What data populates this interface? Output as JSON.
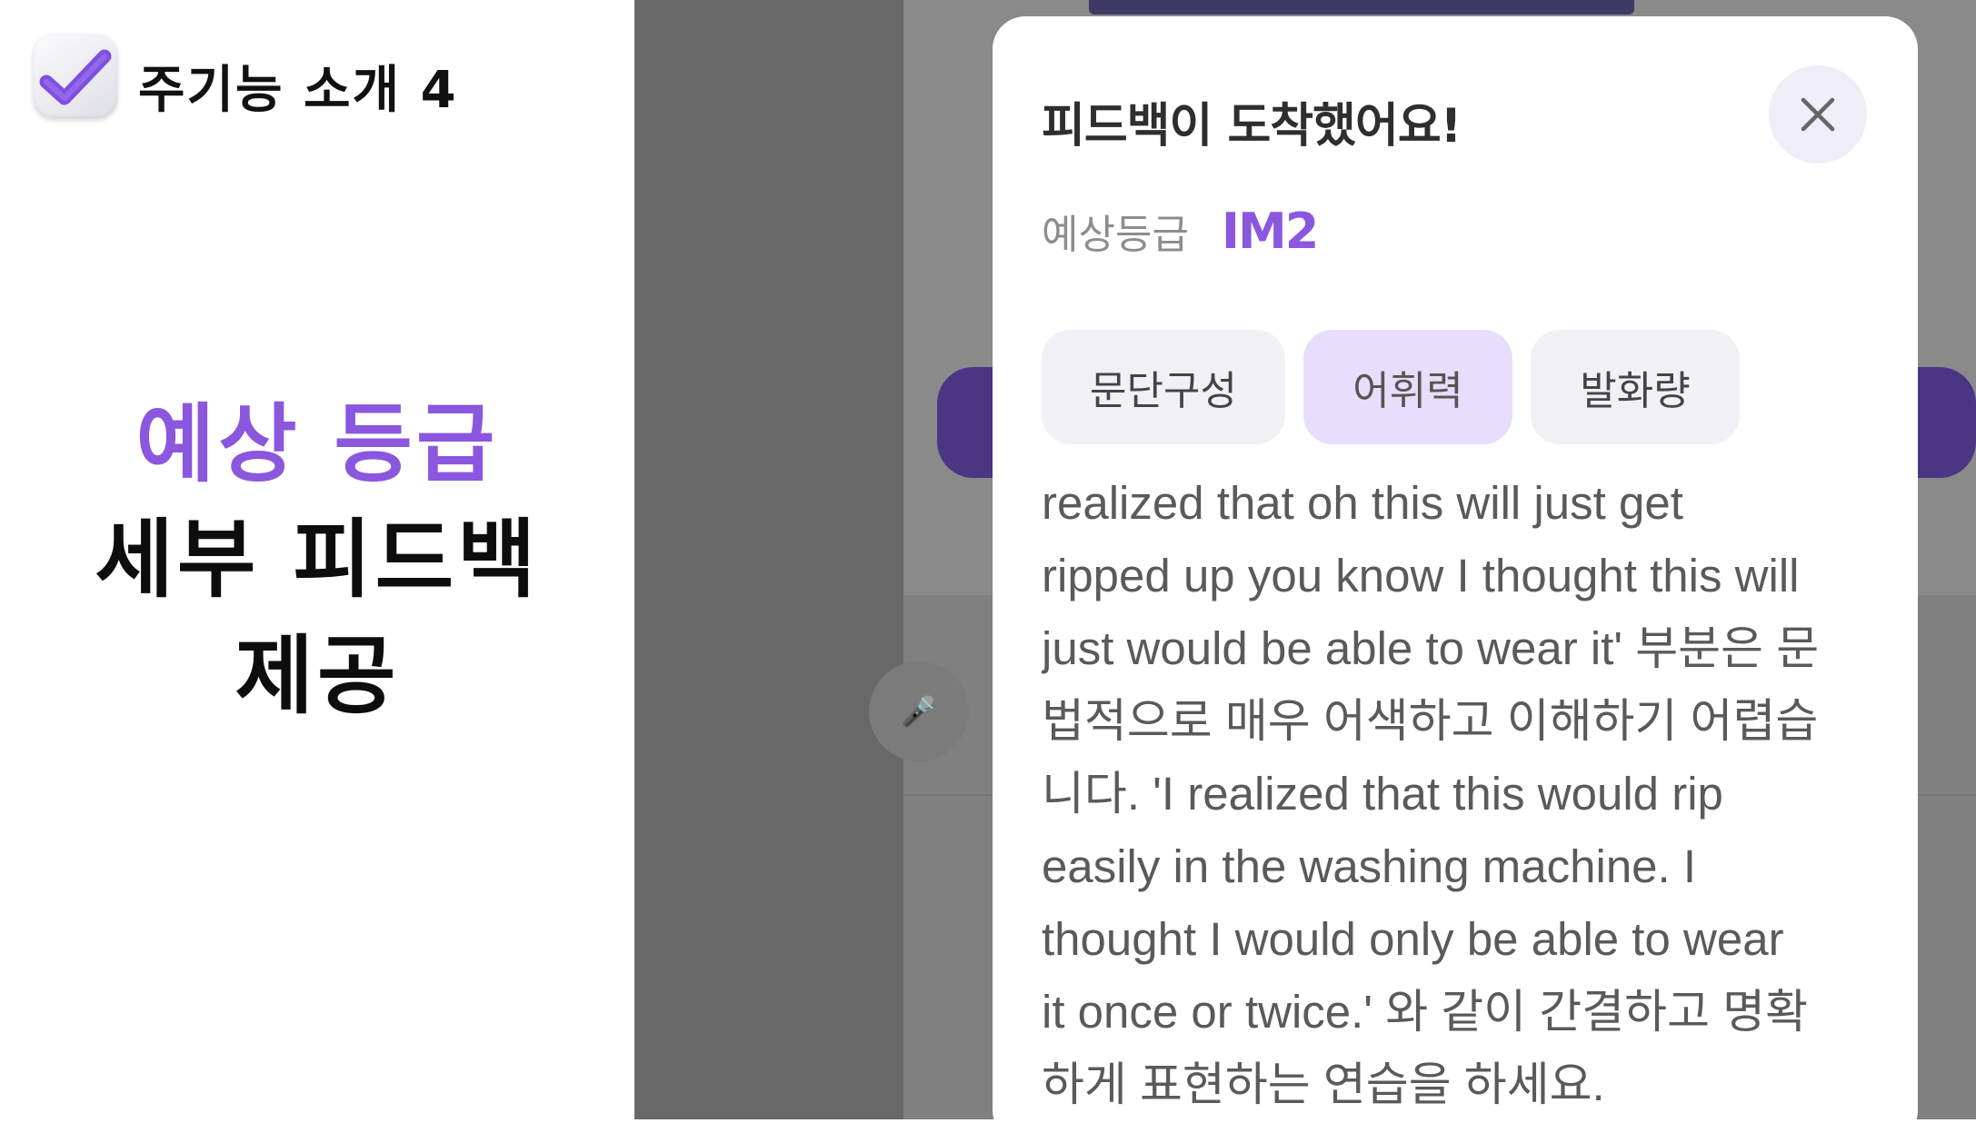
{
  "promo": {
    "feature_title": "주기능 소개 4",
    "headline_purple": "예상 등급",
    "headline_line2": "세부 피드백",
    "headline_line3": "제공"
  },
  "icons": {
    "app": "checkbox-check-icon",
    "close": "close-icon",
    "mic": "microphone-icon"
  },
  "colors": {
    "accent": "#8a57de",
    "active_tab_bg": "#e7defb",
    "tab_bg": "#f1f1f5",
    "backdrop": "#8a8a8a"
  },
  "modal": {
    "title": "피드백이 도착했어요!",
    "grade_label": "예상등급",
    "grade_value": "IM2",
    "tabs": [
      {
        "label": "문단구성",
        "active": false
      },
      {
        "label": "어휘력",
        "active": true
      },
      {
        "label": "발화량",
        "active": false
      }
    ],
    "feedback_text": "realized that oh this will just get\nripped up you know I thought this will\njust would be able to wear it' 부분은 문\n법적으로 매우 어색하고 이해하기 어렵습\n니다. 'I realized that this would rip\neasily in the washing machine. I\nthought I would only be able to wear\nit once or twice.' 와 같이 간결하고 명확\n하게 표현하는 연습을 하세요."
  }
}
